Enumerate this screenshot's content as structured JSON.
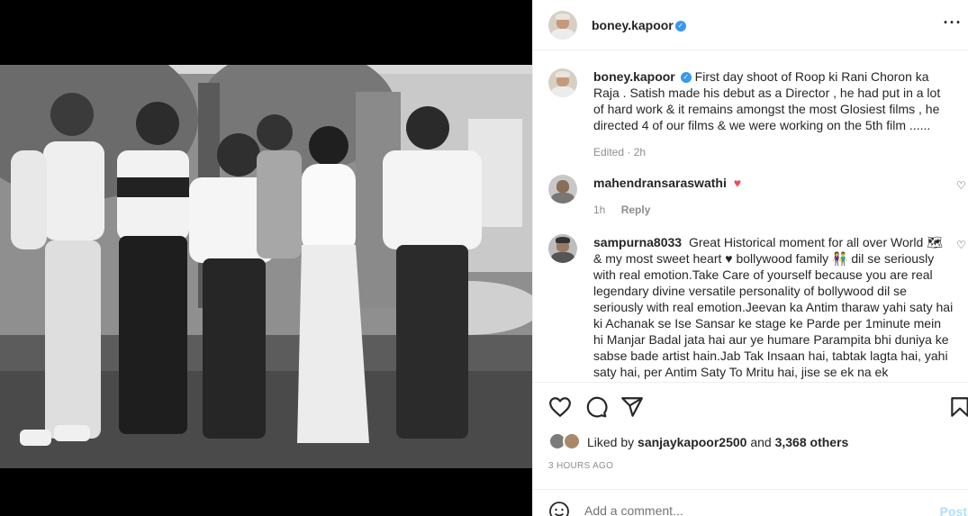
{
  "post": {
    "author": "boney.kapoor",
    "caption": "First day shoot of Roop ki Rani Choron ka Raja . Satish made his debut as a Director , he had put in a lot of hard work & it remains amongst the most Glosiest films , he directed 4 of our films & we were working on the 5th film ......",
    "edited_label": "Edited",
    "edited_time": "2h"
  },
  "comments": [
    {
      "username": "mahendransaraswathi",
      "text": "",
      "time": "1h",
      "reply_label": "Reply"
    },
    {
      "username": "sampurna8033",
      "text": "Great Historical moment for all over World 🗺 & my most sweet heart ♥ bollywood family 👫 dil se seriously with real emotion.Take Care of yourself because you are real legendary divine versatile personality of bollywood dil se seriously with real emotion.Jeevan ka Antim tharaw yahi saty hai ki Achanak se Ise Sansar ke stage ke Parde per 1minute mein hi Manjar Badal jata hai aur ye humare Parampita bhi duniya ke sabse bade artist hain.Jab Tak Insaan hai, tabtak lagta hai, yahi saty hai, per Antim Saty To Mritu hai, jise se ek na ek"
    }
  ],
  "likes": {
    "prefix": "Liked by",
    "user": "sanjaykapoor2500",
    "and": "and",
    "others": "3,368 others"
  },
  "timestamp": "3 HOURS AGO",
  "add_comment": {
    "placeholder": "Add a comment...",
    "post_label": "Post"
  },
  "colors": {
    "verified": "#3897f0",
    "like_heart": "#ed4956",
    "post_disabled": "#b2dffc",
    "meta_gray": "#8e8e8e"
  },
  "icons": [
    "verified-badge-icon",
    "more-options-icon",
    "like-icon",
    "comment-icon",
    "share-icon",
    "save-icon",
    "emoji-icon",
    "heart-small-icon"
  ]
}
